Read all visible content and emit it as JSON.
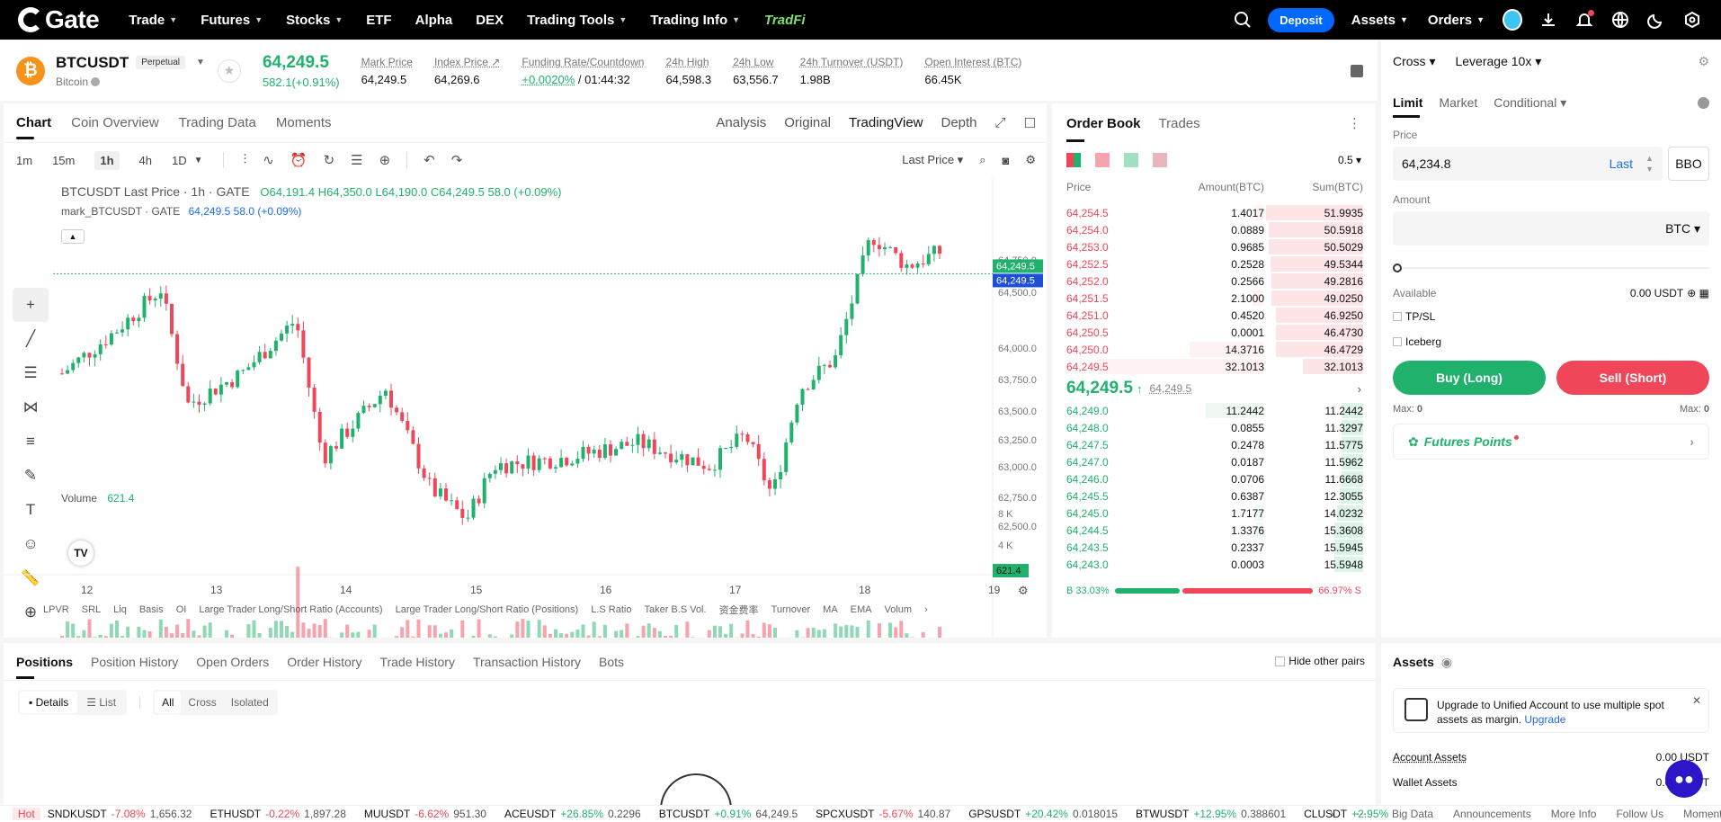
{
  "nav": {
    "logo": "Gate",
    "items": [
      "Trade",
      "Futures",
      "Stocks",
      "ETF",
      "Alpha",
      "DEX",
      "Trading Tools",
      "Trading Info"
    ],
    "carets": [
      true,
      true,
      true,
      false,
      false,
      false,
      true,
      true
    ],
    "tradfi": "TradFi",
    "deposit": "Deposit",
    "assets": "Assets",
    "orders": "Orders"
  },
  "ticker": {
    "symbol": "BTCUSDT",
    "type": "Perpetual",
    "coin": "Bitcoin",
    "last": "64,249.5",
    "change": "582.1(+0.91%)",
    "stats": [
      {
        "label": "Mark Price",
        "value": "64,249.5"
      },
      {
        "label": "Index Price ↗",
        "value": "64,269.6"
      },
      {
        "label": "Funding Rate/Countdown",
        "value": "+0.0020%",
        "value2": " / 01:44:32"
      },
      {
        "label": "24h High",
        "value": "64,598.3"
      },
      {
        "label": "24h Low",
        "value": "63,556.7"
      },
      {
        "label": "24h Turnover (USDT)",
        "value": "1.98B"
      },
      {
        "label": "Open Interest (BTC)",
        "value": "66.45K"
      }
    ]
  },
  "chart": {
    "tabs": [
      "Chart",
      "Coin Overview",
      "Trading Data",
      "Moments"
    ],
    "views": [
      "Analysis",
      "Original",
      "TradingView",
      "Depth"
    ],
    "intervals": [
      "1m",
      "15m",
      "1h",
      "4h",
      "1D"
    ],
    "last_price_sel": "Last Price",
    "legend1": "BTCUSDT Last Price · 1h · GATE",
    "o": "O64,191.4",
    "h": "H64,350.0",
    "l": "L64,190.0",
    "c": "C64,249.5",
    "chg": "58.0 (+0.09%)",
    "legend2": "mark_BTCUSDT · GATE",
    "mark_v": "64,249.5",
    "mark_c": "58.0 (+0.09%)",
    "volume_label": "Volume",
    "volume_value": "621.4",
    "price_ticks": [
      "64,750.0",
      "64,500.0",
      "64,000.0",
      "63,750.0",
      "63,500.0",
      "63,250.0",
      "63,000.0",
      "62,750.0",
      "62,500.0"
    ],
    "price_tag1": "64,249.5",
    "price_tag2": "64,249.5",
    "vol_ticks": [
      "8 K",
      "4 K"
    ],
    "vol_tag": "621.4",
    "date_ticks": [
      "12",
      "13",
      "14",
      "15",
      "16",
      "17",
      "18",
      "19"
    ],
    "indicators": [
      "LPVR",
      "SRL",
      "Liq",
      "Basis",
      "OI",
      "Large Trader Long/Short Ratio (Accounts)",
      "Large Trader Long/Short Ratio (Positions)",
      "L.S Ratio",
      "Taker B.S Vol.",
      "资金费率",
      "Turnover",
      "MA",
      "EMA",
      "Volum"
    ]
  },
  "orderbook": {
    "tabs": [
      "Order Book",
      "Trades"
    ],
    "precision": "0.5",
    "headers": [
      "Price",
      "Amount(BTC)",
      "Sum(BTC)"
    ],
    "asks": [
      [
        "64,254.5",
        "1.4017",
        "51.9935"
      ],
      [
        "64,254.0",
        "0.0889",
        "50.5918"
      ],
      [
        "64,253.0",
        "0.9685",
        "50.5029"
      ],
      [
        "64,252.5",
        "0.2528",
        "49.5344"
      ],
      [
        "64,252.0",
        "0.2566",
        "49.2816"
      ],
      [
        "64,251.5",
        "2.1000",
        "49.0250"
      ],
      [
        "64,251.0",
        "0.4520",
        "46.9250"
      ],
      [
        "64,250.5",
        "0.0001",
        "46.4730"
      ],
      [
        "64,250.0",
        "14.3716",
        "46.4729"
      ],
      [
        "64,249.5",
        "32.1013",
        "32.1013"
      ]
    ],
    "mid": "64,249.5",
    "mid_mark": "64,249.5",
    "bids": [
      [
        "64,249.0",
        "11.2442",
        "11.2442"
      ],
      [
        "64,248.0",
        "0.0855",
        "11.3297"
      ],
      [
        "64,247.5",
        "0.2478",
        "11.5775"
      ],
      [
        "64,247.0",
        "0.0187",
        "11.5962"
      ],
      [
        "64,246.0",
        "0.0706",
        "11.6668"
      ],
      [
        "64,245.5",
        "0.6387",
        "12.3055"
      ],
      [
        "64,245.0",
        "1.7177",
        "14.0232"
      ],
      [
        "64,244.5",
        "1.3376",
        "15.3608"
      ],
      [
        "64,243.5",
        "0.2337",
        "15.5945"
      ],
      [
        "64,243.0",
        "0.0003",
        "15.5948"
      ]
    ],
    "buy_pct": "B 33.03%",
    "sell_pct": "66.97% S",
    "buy_ratio": 0.3303
  },
  "orderform": {
    "margin": "Cross",
    "leverage": "Leverage 10x",
    "types": [
      "Limit",
      "Market",
      "Conditional"
    ],
    "price_label": "Price",
    "price_value": "64,234.8",
    "last": "Last",
    "bbo": "BBO",
    "amount_label": "Amount",
    "amount_unit": "BTC",
    "available_label": "Available",
    "available": "0.00 USDT",
    "tpsl": "TP/SL",
    "iceberg": "Iceberg",
    "buy": "Buy (Long)",
    "sell": "Sell (Short)",
    "max_buy": "Max:",
    "max_buy_v": "0",
    "max_sell": "Max:",
    "max_sell_v": "0",
    "points": "Futures Points"
  },
  "positions": {
    "tabs": [
      "Positions",
      "Position History",
      "Open Orders",
      "Order History",
      "Trade History",
      "Transaction History",
      "Bots"
    ],
    "hide": "Hide other pairs",
    "views": [
      "Details",
      "List"
    ],
    "filters": [
      "All",
      "Cross",
      "Isolated"
    ]
  },
  "assets": {
    "title": "Assets",
    "upgrade_text": "Upgrade to Unified Account to use multiple spot assets as margin.",
    "upgrade_link": "Upgrade",
    "account": "Account Assets",
    "account_v": "0.00 USDT",
    "wallet": "Wallet Assets",
    "wallet_v": "0.00 USDT"
  },
  "bottom": {
    "hot": "Hot",
    "items": [
      [
        "SNDKUSDT",
        "-7.08%",
        "1,656.32"
      ],
      [
        "ETHUSDT",
        "-0.22%",
        "1,897.28"
      ],
      [
        "MUUSDT",
        "-6.62%",
        "951.30"
      ],
      [
        "ACEUSDT",
        "+26.85%",
        "0.2296"
      ],
      [
        "BTCUSDT",
        "+0.91%",
        "64,249.5"
      ],
      [
        "SPCXUSDT",
        "-5.67%",
        "140.87"
      ],
      [
        "GPSUSDT",
        "+20.42%",
        "0.018015"
      ],
      [
        "BTWUSDT",
        "+12.95%",
        "0.388601"
      ],
      [
        "CLUSDT",
        "+2.95%",
        ""
      ]
    ],
    "links": [
      "Big Data",
      "Announcements",
      "More Info",
      "Follow Us",
      "Moments"
    ]
  },
  "colors": {
    "up": "#20b26c",
    "down": "#f0465a",
    "brand": "#0068ff"
  }
}
